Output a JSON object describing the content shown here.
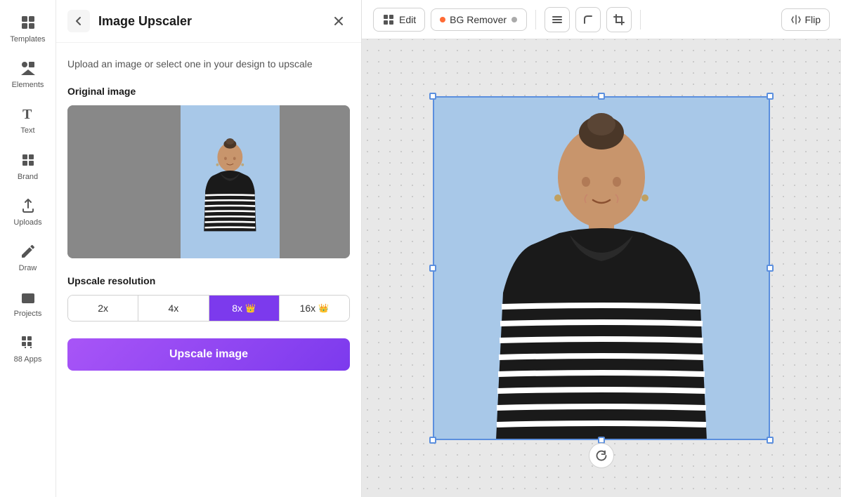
{
  "sidebar": {
    "items": [
      {
        "id": "templates",
        "label": "Templates",
        "icon": "grid"
      },
      {
        "id": "elements",
        "label": "Elements",
        "icon": "shapes"
      },
      {
        "id": "text",
        "label": "Text",
        "icon": "T"
      },
      {
        "id": "brand",
        "label": "Brand",
        "icon": "diamond"
      },
      {
        "id": "uploads",
        "label": "Uploads",
        "icon": "upload"
      },
      {
        "id": "draw",
        "label": "Draw",
        "icon": "pencil"
      },
      {
        "id": "projects",
        "label": "Projects",
        "icon": "folder"
      },
      {
        "id": "apps",
        "label": "88 Apps",
        "icon": "apps"
      }
    ]
  },
  "panel": {
    "title": "Image Upscaler",
    "description": "Upload an image or select one in your design to upscale",
    "back_label": "back",
    "close_label": "close",
    "original_image_label": "Original image",
    "upscale_resolution_label": "Upscale resolution",
    "resolution_options": [
      {
        "id": "2x",
        "label": "2x",
        "premium": false,
        "active": false
      },
      {
        "id": "4x",
        "label": "4x",
        "premium": false,
        "active": false
      },
      {
        "id": "8x",
        "label": "8x",
        "premium": true,
        "active": true
      },
      {
        "id": "16x",
        "label": "16x",
        "premium": true,
        "active": false
      }
    ],
    "upscale_button_label": "Upscale image"
  },
  "toolbar": {
    "edit_label": "Edit",
    "bg_remover_label": "BG Remover",
    "flip_label": "Flip",
    "divider1": true,
    "divider2": true
  },
  "canvas": {
    "background_color": "#a8c8e8"
  }
}
